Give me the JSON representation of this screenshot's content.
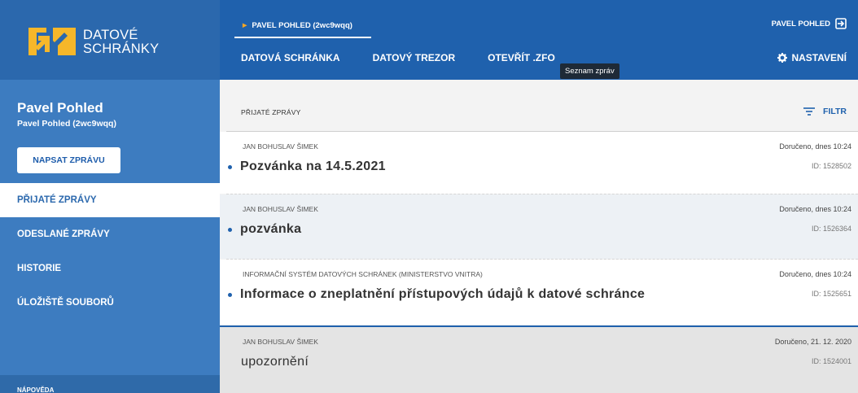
{
  "logo": {
    "line1": "DATOVÉ",
    "line2": "SCHRÁNKY",
    "accent_color": "#f6b72a"
  },
  "user": {
    "name": "Pavel Pohled",
    "id_line": "Pavel Pohled (2wc9wqq)"
  },
  "sidebar": {
    "write_button": "NAPSAT ZPRÁVU",
    "items": [
      {
        "label": "PŘIJATÉ ZPRÁVY",
        "active": true
      },
      {
        "label": "ODESLANÉ ZPRÁVY",
        "active": false
      },
      {
        "label": "HISTORIE",
        "active": false
      },
      {
        "label": "ÚLOŽIŠTĚ SOUBORŮ",
        "active": false
      }
    ],
    "help": "NÁPOVĚDA"
  },
  "topbar": {
    "breadcrumb": "PAVEL POHLED (2wc9wqq)",
    "account": "PAVEL POHLED",
    "tabs": [
      "DATOVÁ SCHRÁNKA",
      "DATOVÝ TREZOR",
      "OTEVŘÍT .ZFO"
    ],
    "tooltip": "Seznam zpráv",
    "settings": "NASTAVENÍ"
  },
  "list": {
    "title": "PŘIJATÉ ZPRÁVY",
    "filter": "FILTR",
    "messages": [
      {
        "sender": "JAN BOHUSLAV ŠIMEK",
        "subject": "Pozvánka na 14.5.2021",
        "date": "Doručeno, dnes 10:24",
        "id": "ID: 1528502",
        "unread": true
      },
      {
        "sender": "JAN BOHUSLAV ŠIMEK",
        "subject": "pozvánka",
        "date": "Doručeno, dnes 10:24",
        "id": "ID: 1526364",
        "unread": true
      },
      {
        "sender": "INFORMAČNÍ SYSTÉM DATOVÝCH SCHRÁNEK (MINISTERSTVO VNITRA)",
        "subject": "Informace o zneplatnění přístupových údajů k datové schránce",
        "date": "Doručeno, dnes 10:24",
        "id": "ID: 1525651",
        "unread": true
      },
      {
        "sender": "JAN BOHUSLAV ŠIMEK",
        "subject": "upozornění",
        "date": "Doručeno, 21. 12. 2020",
        "id": "ID: 1524001",
        "unread": false
      }
    ]
  }
}
